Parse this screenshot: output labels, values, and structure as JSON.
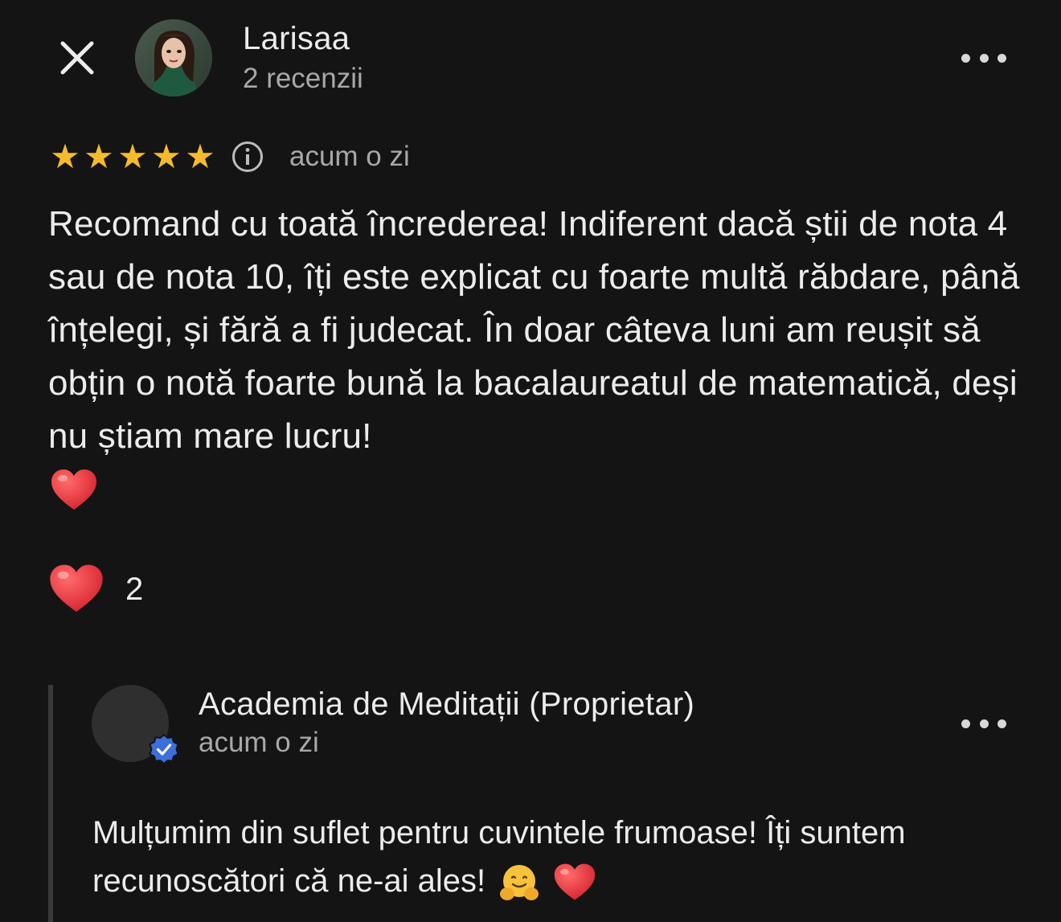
{
  "review": {
    "reviewer_name": "Larisaa",
    "review_count": "2 recenzii",
    "rating": 5,
    "max_rating": 5,
    "time": "acum o zi",
    "text": "Recomand cu toată încrederea! Indiferent dacă știi de nota 4 sau de nota 10, îți este explicat cu foarte multă răbdare, până înțelegi, și fără a fi judecat. În doar câteva luni am reușit să obțin o notă foarte bună la bacalaureatul de matematică, deși nu știam mare lucru!",
    "reaction_count": "2"
  },
  "reply": {
    "owner_name": "Academia de Meditații (Proprietar)",
    "time": "acum o zi",
    "text": "Mulțumim din suflet pentru cuvintele frumoase! Îți suntem recunoscători că ne-ai ales!"
  },
  "colors": {
    "background": "#141414",
    "star": "#f6bb2c",
    "verified": "#3b6fd9",
    "heart": "#e0262f"
  },
  "icons": {
    "close": "close-icon",
    "more": "more-horizontal-icon",
    "info": "info-icon",
    "heart": "heart-emoji",
    "hug": "hugging-face-emoji",
    "verified": "verified-badge-icon"
  }
}
